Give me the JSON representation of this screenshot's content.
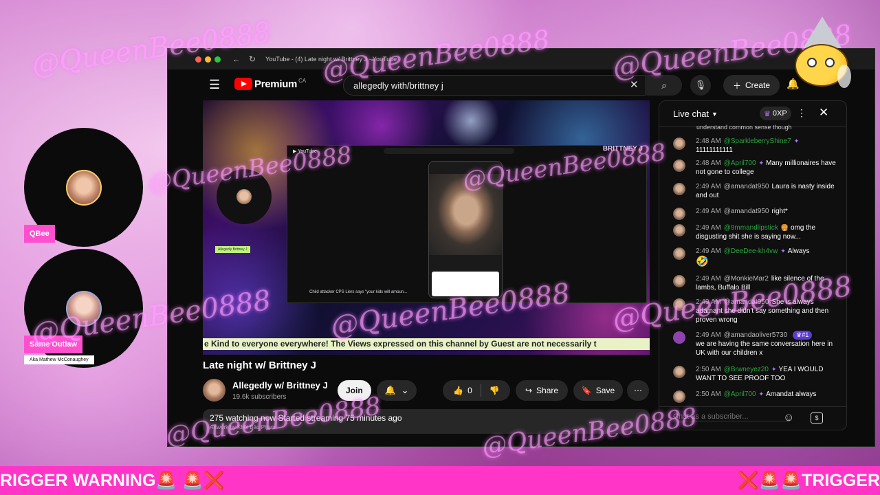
{
  "browser": {
    "tab_title": "YouTube - (4) Late night w/ Brittney J - YouTube"
  },
  "youtube": {
    "brand": "Premium",
    "region": "CA",
    "search_value": "allegedly with/brittney j",
    "create_label": "Create"
  },
  "video": {
    "inner_caption": "Child attacker CPS Liers says \"your kids will amoun...",
    "inner_avatar_label": "Allegedly Brittney J",
    "overlay_name": "BRITTNEY J",
    "ticker": "e Kind to everyone everywhere! The Views expressed on this channel by Guest are not necessarily t"
  },
  "meta": {
    "title": "Late night w/ Brittney J",
    "channel_name": "Allegedly w/ Brittney J",
    "subscribers": "19.6k subscribers",
    "join_label": "Join",
    "like_count": "0",
    "share_label": "Share",
    "save_label": "Save",
    "stats": "275 watching now  Started streaming 75 minutes ago",
    "artwork_credit": "Artwork by Khôi Bảo Phạm"
  },
  "chat": {
    "title": "Live chat",
    "xp": "0XP",
    "prev_line": "understand common sense though",
    "input_placeholder": "Chat as a subscriber...",
    "messages": [
      {
        "time": "2:48 AM",
        "author": "@SparkleberryShine7",
        "badge": "✦",
        "text": "11111111111"
      },
      {
        "time": "2:48 AM",
        "author": "@April700",
        "badge": "✦",
        "text": "Many millionaires have not gone to college"
      },
      {
        "time": "2:49 AM",
        "author": "@amandat950",
        "badge": "",
        "text": "Laura is nasty inside and out"
      },
      {
        "time": "2:49 AM",
        "author": "@amandat950",
        "badge": "",
        "text": "right*"
      },
      {
        "time": "2:49 AM",
        "author": "@9mmandlipstick",
        "badge": "🍔",
        "text": "omg the disgusting shit she is saying now..."
      },
      {
        "time": "2:49 AM",
        "author": "@DeeDee-kh4vw",
        "badge": "✦",
        "text": "Always",
        "emoji": "🤣"
      },
      {
        "time": "2:49 AM",
        "author": "@MonkieMar2",
        "badge": "",
        "text": "like silence of the lambs, Buffalo Bill"
      },
      {
        "time": "2:49 AM",
        "author": "@amandat950",
        "badge": "",
        "text": "She is always adamant she didn't say something and then proven wrong"
      },
      {
        "time": "2:49 AM",
        "author": "@amandaoliver5730",
        "badge": "",
        "rank": "#1",
        "text": "we are having the same conversation here in UK with our children x"
      },
      {
        "time": "2:50 AM",
        "author": "@Brwneyez20",
        "badge": "✦",
        "text": "YEA I WOULD WANT TO SEE PROOF TOO"
      },
      {
        "time": "2:50 AM",
        "author": "@April700",
        "badge": "✦",
        "text": "Amandat always"
      }
    ]
  },
  "participants": {
    "p1_name": "QBee",
    "p2_name": "Same Outlaw",
    "p2_aka": "Aka Mathew McConaughey"
  },
  "watermark": "@QueenBee0888",
  "banner": {
    "left": "RIGGER WARNING🚨 🚨❌",
    "right": "❌🚨🚨TRIGGER"
  }
}
